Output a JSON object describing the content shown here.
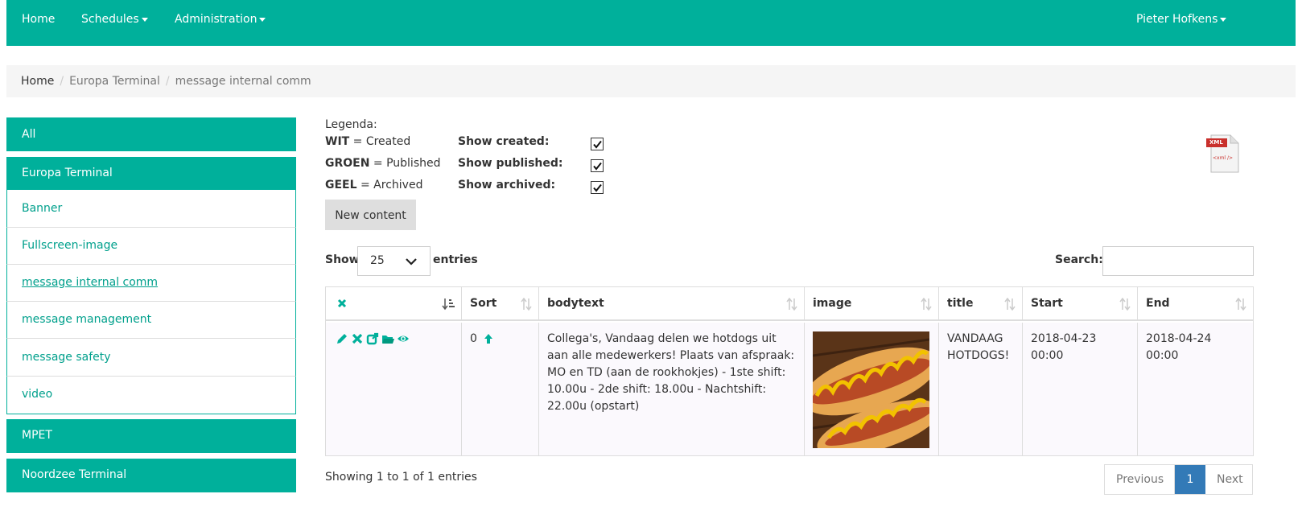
{
  "colors": {
    "brand": "#00b09b",
    "link": "#00a08c",
    "active_page": "#337ab7",
    "row_bg": "#fbf9fd"
  },
  "navbar": {
    "home": "Home",
    "schedules": "Schedules",
    "administration": "Administration",
    "user": "Pieter Hofkens"
  },
  "breadcrumb": {
    "home": "Home",
    "terminal": "Europa Terminal",
    "current": "message internal comm"
  },
  "sidebar": {
    "all": "All",
    "europa": "Europa Terminal",
    "items": [
      "Banner",
      "Fullscreen-image",
      "message internal comm",
      "message management",
      "message safety",
      "video"
    ],
    "mpet": "MPET",
    "noordzee": "Noordzee Terminal"
  },
  "legend": {
    "title": "Legenda:",
    "wit_key": "WIT",
    "wit_val": "= Created",
    "groen_key": "GROEN",
    "groen_val": "= Published",
    "geel_key": "GEEL",
    "geel_val": "= Archived",
    "show_created": "Show created:",
    "show_published": "Show published:",
    "show_archived": "Show archived:",
    "created_checked": true,
    "published_checked": true,
    "archived_checked": true
  },
  "export_icon": "xml-file-icon",
  "export_label": "XML",
  "export_tag": "<xml />",
  "new_content": "New content",
  "length": {
    "show": "Show",
    "value": "25",
    "entries": "entries"
  },
  "search": {
    "label": "Search:",
    "value": ""
  },
  "table": {
    "headers": {
      "sort": "Sort",
      "bodytext": "bodytext",
      "image": "image",
      "title": "title",
      "start": "Start",
      "end": "End"
    },
    "row": {
      "actions": [
        "edit-icon",
        "delete-icon",
        "open-external-icon",
        "folder-icon",
        "preview-eye-icon"
      ],
      "sort": "0",
      "bodytext": "Collega's, Vandaag delen we hotdogs uit aan alle medewerkers! Plaats van afspraak: MO en TD (aan de rookhokjes) - 1ste shift: 10.00u - 2de shift: 18.00u - Nachtshift: 22.00u (opstart)",
      "image": "hotdog-photo",
      "title": "VANDAAG HOTDOGS!",
      "start": "2018-04-23 00:00",
      "end": "2018-04-24 00:00"
    }
  },
  "info": "Showing 1 to 1 of 1 entries",
  "pagination": {
    "previous": "Previous",
    "current": "1",
    "next": "Next"
  }
}
